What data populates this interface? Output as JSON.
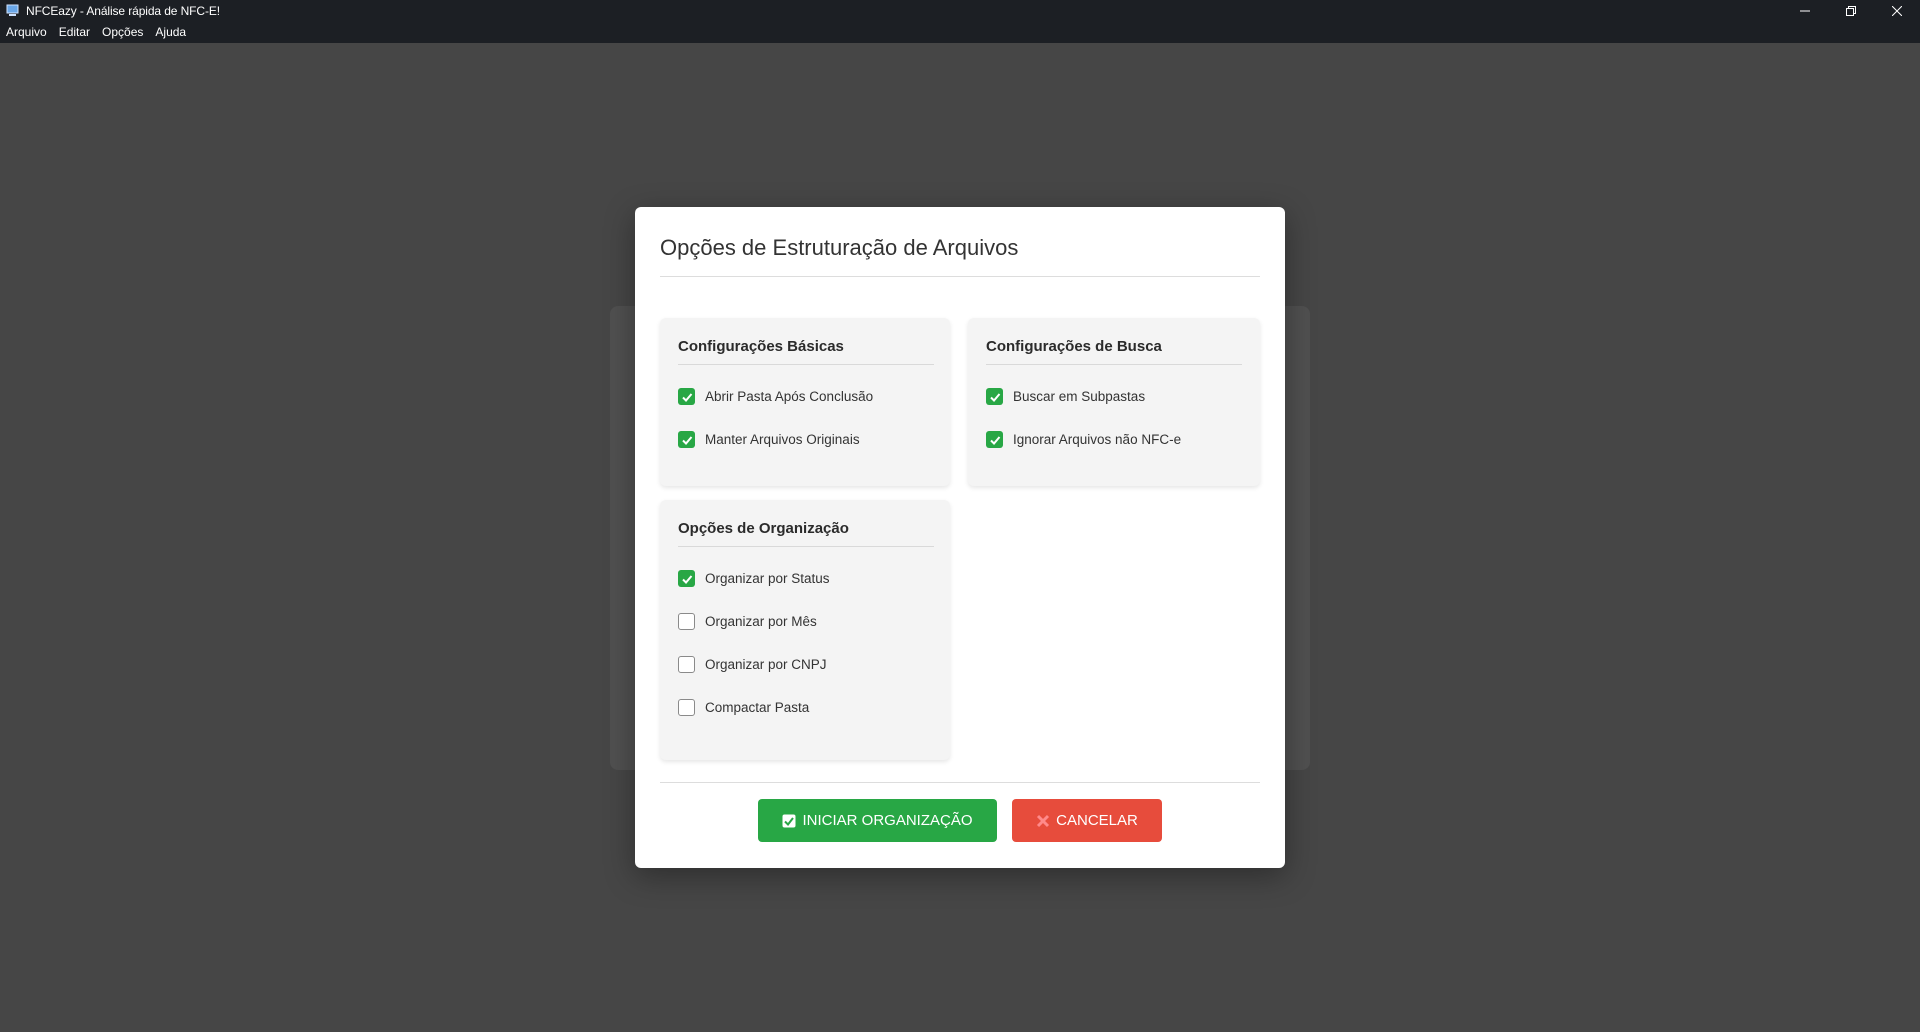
{
  "window": {
    "title": "NFCEazy - Análise rápida de NFC-E!",
    "icon": "computer-icon",
    "controls": [
      "minimize-icon",
      "restore-icon",
      "close-icon"
    ]
  },
  "menu": [
    "Arquivo",
    "Editar",
    "Opções",
    "Ajuda"
  ],
  "dialog": {
    "title": "Opções de Estruturação de Arquivos",
    "sections": {
      "basic": {
        "title": "Configurações Básicas",
        "options": [
          {
            "label": "Abrir Pasta Após Conclusão",
            "checked": true
          },
          {
            "label": "Manter Arquivos Originais",
            "checked": true
          }
        ]
      },
      "search": {
        "title": "Configurações de Busca",
        "options": [
          {
            "label": "Buscar em Subpastas",
            "checked": true
          },
          {
            "label": "Ignorar Arquivos não NFC-e",
            "checked": true
          }
        ]
      },
      "organization": {
        "title": "Opções de Organização",
        "options": [
          {
            "label": "Organizar por Status",
            "checked": true
          },
          {
            "label": "Organizar por Mês",
            "checked": false
          },
          {
            "label": "Organizar por CNPJ",
            "checked": false
          },
          {
            "label": "Compactar Pasta",
            "checked": false
          }
        ]
      }
    },
    "buttons": {
      "start": {
        "label": "INICIAR ORGANIZAÇÃO",
        "icon": "check-square-icon"
      },
      "cancel": {
        "label": "CANCELAR",
        "icon": "x-icon"
      }
    }
  },
  "colors": {
    "accent_green": "#28a745",
    "danger_red": "#e74c3c",
    "titlebar": "#1c1f24",
    "backdrop": "#464646"
  }
}
